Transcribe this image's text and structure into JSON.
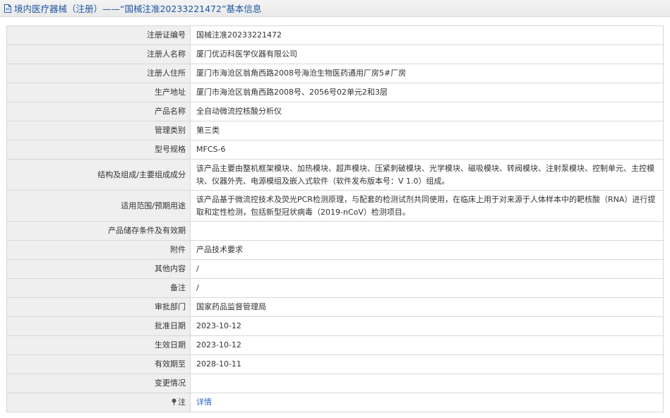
{
  "header": {
    "title": "境内医疗器械（注册）——“国械注准20233221472”基本信息",
    "doc_icon": "document-icon"
  },
  "rows": [
    {
      "label": "注册证编号",
      "value": "国械注准20233221472"
    },
    {
      "label": "注册人名称",
      "value": "厦门优迈科医学仪器有限公司"
    },
    {
      "label": "注册人住所",
      "value": "厦门市海沧区翁角西路2008号海沧生物医药通用厂房5#厂房"
    },
    {
      "label": "生产地址",
      "value": "厦门市海沧区翁角西路2008号、2056号02单元2和3层"
    },
    {
      "label": "产品名称",
      "value": "全自动微流控核酸分析仪"
    },
    {
      "label": "管理类别",
      "value": "第三类"
    },
    {
      "label": "型号规格",
      "value": "MFCS-6"
    },
    {
      "label": "结构及组成/主要组成成分",
      "value": "该产品主要由整机框架模块、加热模块、超声模块、压紧刺破模块、光学模块、磁吸模块、转阀模块、注射泵模块、控制单元、主控模块、仪器外壳、电源模组及嵌入式软件（软件发布版本号：V 1.0）组成。"
    },
    {
      "label": "适用范围/预期用途",
      "value": "该产品基于微流控技术及荧光PCR检测原理，与配套的检测试剂共同使用，在临床上用于对来源于人体样本中的靶核酸（RNA）进行提取和定性检测，包括新型冠状病毒（2019-nCoV）检测项目。"
    },
    {
      "label": "产品储存条件及有效期",
      "value": ""
    },
    {
      "label": "附件",
      "value": "产品技术要求"
    },
    {
      "label": "其他内容",
      "value": "/"
    },
    {
      "label": "备注",
      "value": "/"
    },
    {
      "label": "审批部门",
      "value": "国家药品监督管理局"
    },
    {
      "label": "批准日期",
      "value": "2023-10-12"
    },
    {
      "label": "生效日期",
      "value": "2023-10-12"
    },
    {
      "label": "有效期至",
      "value": "2028-10-11"
    },
    {
      "label": "变更情况",
      "value": ""
    }
  ],
  "note": {
    "label": "注",
    "link": "详情",
    "icon": "pin-icon"
  }
}
